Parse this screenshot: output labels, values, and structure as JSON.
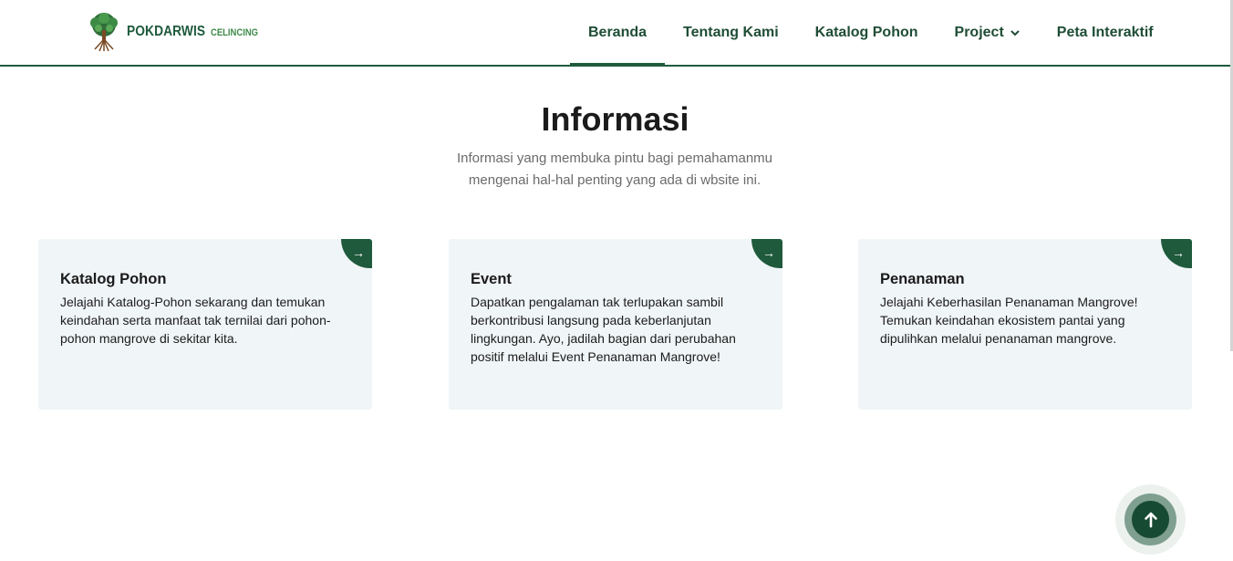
{
  "brand": {
    "name": "POKDARWIS",
    "sub": "CELINCING",
    "logo_icon": "tree-logo-icon",
    "colors": {
      "primary": "#1f5a3c",
      "accent": "#3f8a4a"
    }
  },
  "nav": {
    "items": [
      {
        "label": "Beranda",
        "active": true
      },
      {
        "label": "Tentang Kami"
      },
      {
        "label": "Katalog Pohon"
      },
      {
        "label": "Project",
        "dropdown": true
      },
      {
        "label": "Peta Interaktif"
      }
    ]
  },
  "section": {
    "title": "Informasi",
    "subtitle": "Informasi yang membuka pintu bagi pemahamanmu mengenai hal-hal penting yang ada di wbsite ini."
  },
  "cards": [
    {
      "title": "Katalog Pohon",
      "text": "Jelajahi Katalog-Pohon sekarang dan temukan keindahan serta manfaat tak ternilai dari pohon-pohon mangrove di sekitar kita.",
      "arrow": "→"
    },
    {
      "title": "Event",
      "text": "Dapatkan pengalaman tak terlupakan sambil berkontribusi langsung pada keberlanjutan lingkungan. Ayo, jadilah bagian dari perubahan positif melalui Event Penanaman Mangrove!",
      "arrow": "→"
    },
    {
      "title": "Penanaman",
      "text": "Jelajahi Keberhasilan Penanaman Mangrove! Temukan keindahan ekosistem pantai yang dipulihkan melalui penanaman mangrove.",
      "arrow": "→"
    }
  ],
  "back_to_top": {
    "icon": "arrow-up-icon"
  }
}
